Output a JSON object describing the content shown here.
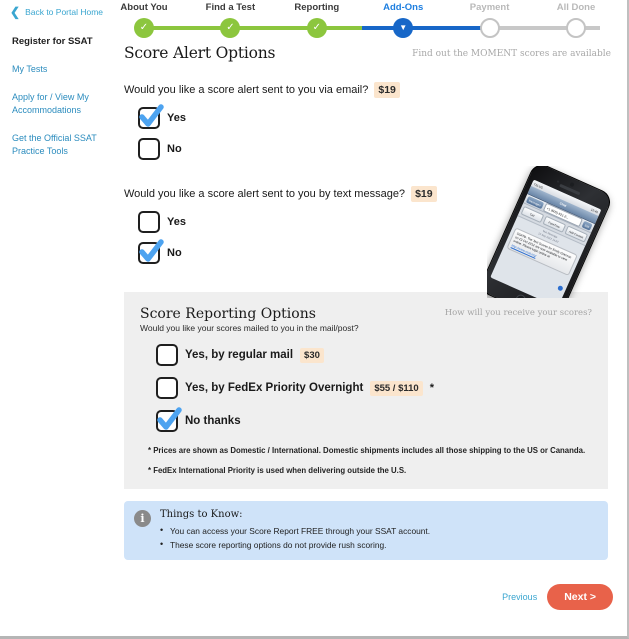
{
  "topbar": {
    "back_label": "Back to Portal Home",
    "back_icon": "chevron-left-icon"
  },
  "stepper": {
    "steps": [
      {
        "label": "About You",
        "state": "done",
        "glyph": "✓"
      },
      {
        "label": "Find a Test",
        "state": "done",
        "glyph": "✓"
      },
      {
        "label": "Reporting",
        "state": "done",
        "glyph": "✓"
      },
      {
        "label": "Add-Ons",
        "state": "active",
        "glyph": "▼"
      },
      {
        "label": "Payment",
        "state": "todo",
        "glyph": ""
      },
      {
        "label": "All Done",
        "state": "todo",
        "glyph": ""
      }
    ],
    "colors": {
      "done": "#8cc63e",
      "active": "#1767c8",
      "todo": "#c8c8c8"
    }
  },
  "sidebar": {
    "title": "Register for SSAT",
    "links": [
      "My Tests",
      "Apply for / View My Accommodations",
      "Get the Official SSAT Practice Tools"
    ]
  },
  "main": {
    "title": "Score Alert Options",
    "hint": "Find out the MOMENT scores are available",
    "email_question": "Would you like a score alert sent to you via email?",
    "email_price": "$19",
    "email_options": [
      {
        "label": "Yes",
        "checked": true
      },
      {
        "label": "No",
        "checked": false
      }
    ],
    "text_question": "Would you like a score alert sent to you by text message?",
    "text_price": "$19",
    "text_options": [
      {
        "label": "Yes",
        "checked": false
      },
      {
        "label": "No",
        "checked": true
      }
    ]
  },
  "phone": {
    "alt": "iphone-sms-score-alert",
    "status_left": "TELUS",
    "status_right": "12:40",
    "nav_title": "Chat",
    "back_button": "Messages",
    "number": "+1 (605) 621-2...",
    "edit_button": "Edit",
    "actions": [
      "Call",
      "FaceTime",
      "Add Contact"
    ],
    "text_label": "Text Message",
    "timestamp": "12 Sep 2012 14:02",
    "message": "SSATB: The Test Scores for Emily Grierson on 13 Oct 2012 are now available to view online. Please login online at",
    "message_link": "http://www.ssat.org/"
  },
  "report": {
    "title": "Score Reporting Options",
    "subtitle": "Would you like your scores mailed to you in the mail/post?",
    "hint": "How will you receive your scores?",
    "options": [
      {
        "label": "Yes, by regular mail",
        "price": "$30",
        "star": false,
        "checked": false
      },
      {
        "label": "Yes, by FedEx Priority Overnight",
        "price": "$55 / $110",
        "star": true,
        "checked": false
      },
      {
        "label": "No thanks",
        "price": "",
        "star": false,
        "checked": true
      }
    ],
    "note1": "* Prices are shown as Domestic / International. Domestic shipments includes all those shipping to the US or Cananda.",
    "note2": "* FedEx International Priority is used when delivering outside the U.S."
  },
  "things_to_know": {
    "icon": "info-icon",
    "title": "Things to Know:",
    "items": [
      "You can access your Score Report FREE through your SSAT account.",
      "These score reporting options do not provide rush scoring."
    ]
  },
  "footer": {
    "previous_label": "Previous",
    "next_label": "Next >"
  },
  "colors": {
    "accent_blue": "#3aa6d0",
    "active_blue": "#1767c8",
    "done_green": "#8cc63e",
    "price_bg": "#fbe5cd",
    "next_orange": "#e8624a",
    "info_bg": "#cfe3f9",
    "panel_bg": "#efefef",
    "check_blue": "#4da3f0"
  }
}
